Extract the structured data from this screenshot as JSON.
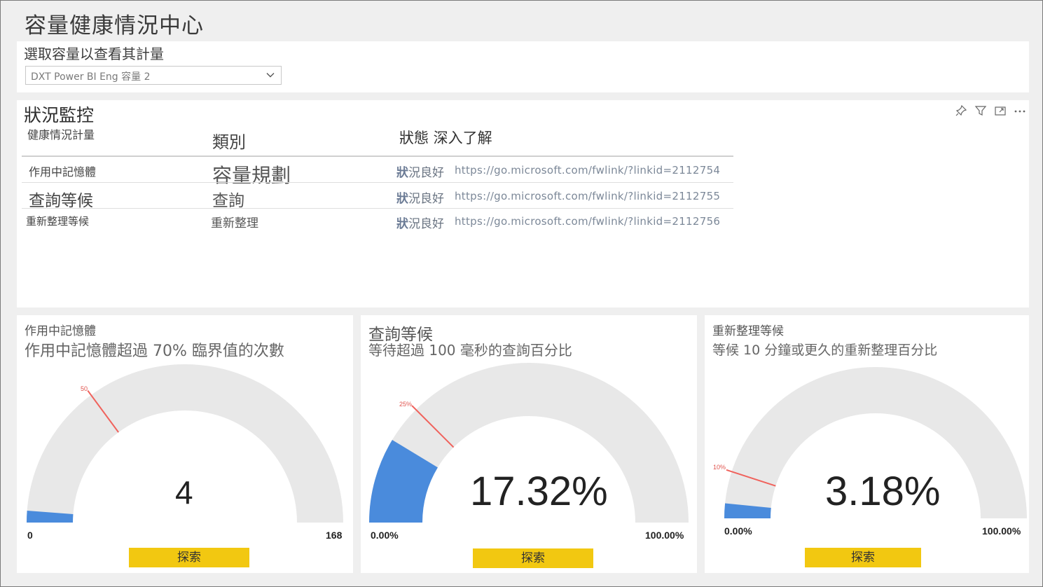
{
  "page": {
    "title": "容量健康情況中心"
  },
  "selector": {
    "label": "選取容量以查看其計量",
    "value": "DXT Power BI Eng 容量 2"
  },
  "status": {
    "title": "狀況監控",
    "icons": [
      "pin-icon",
      "filter-icon",
      "focus-mode-icon",
      "more-options-icon"
    ],
    "columns": {
      "metric": "健康情況計量",
      "category": "類別",
      "status": "狀態 深入了解"
    },
    "rows": [
      {
        "metric": "作用中記憶體",
        "category": "容量規劃",
        "status_bold": "狀",
        "status_rest": "況良好",
        "link": "https://go.microsoft.com/fwlink/?linkid=2112754"
      },
      {
        "metric": "查詢等候",
        "category": "查詢",
        "status_bold": "狀",
        "status_rest": "況良好",
        "link": "https://go.microsoft.com/fwlink/?linkid=2112755"
      },
      {
        "metric": "重新整理等候",
        "category": "重新整理",
        "status_bold": "狀",
        "status_rest": "況良好",
        "link": "https://go.microsoft.com/fwlink/?linkid=2112756"
      }
    ]
  },
  "gauges": [
    {
      "id": "memory",
      "name": "作用中記憶體",
      "subtitle": "作用中記憶體超過 70% 臨界值的次數",
      "value_label": "4",
      "value_fraction": 0.024,
      "target_label": "50",
      "target_fraction": 0.298,
      "min_label": "0",
      "max_label": "168",
      "explore": "探索"
    },
    {
      "id": "query",
      "name": "查詢等候",
      "subtitle": "等待超過 100 毫秒的查詢百分比",
      "value_label": "17.32%",
      "value_fraction": 0.1732,
      "target_label": "25%",
      "target_fraction": 0.25,
      "min_label": "0.00%",
      "max_label": "100.00%",
      "explore": "探索"
    },
    {
      "id": "refresh",
      "name": "重新整理等候",
      "subtitle": "等候 10 分鐘或更久的重新整理百分比",
      "value_label": "3.18%",
      "value_fraction": 0.0318,
      "target_label": "10%",
      "target_fraction": 0.1,
      "min_label": "0.00%",
      "max_label": "100.00%",
      "explore": "探索"
    }
  ],
  "colors": {
    "fill": "#4a8bdc",
    "track": "#e8e8e8",
    "target": "#f0625c",
    "explore": "#f2c811"
  }
}
